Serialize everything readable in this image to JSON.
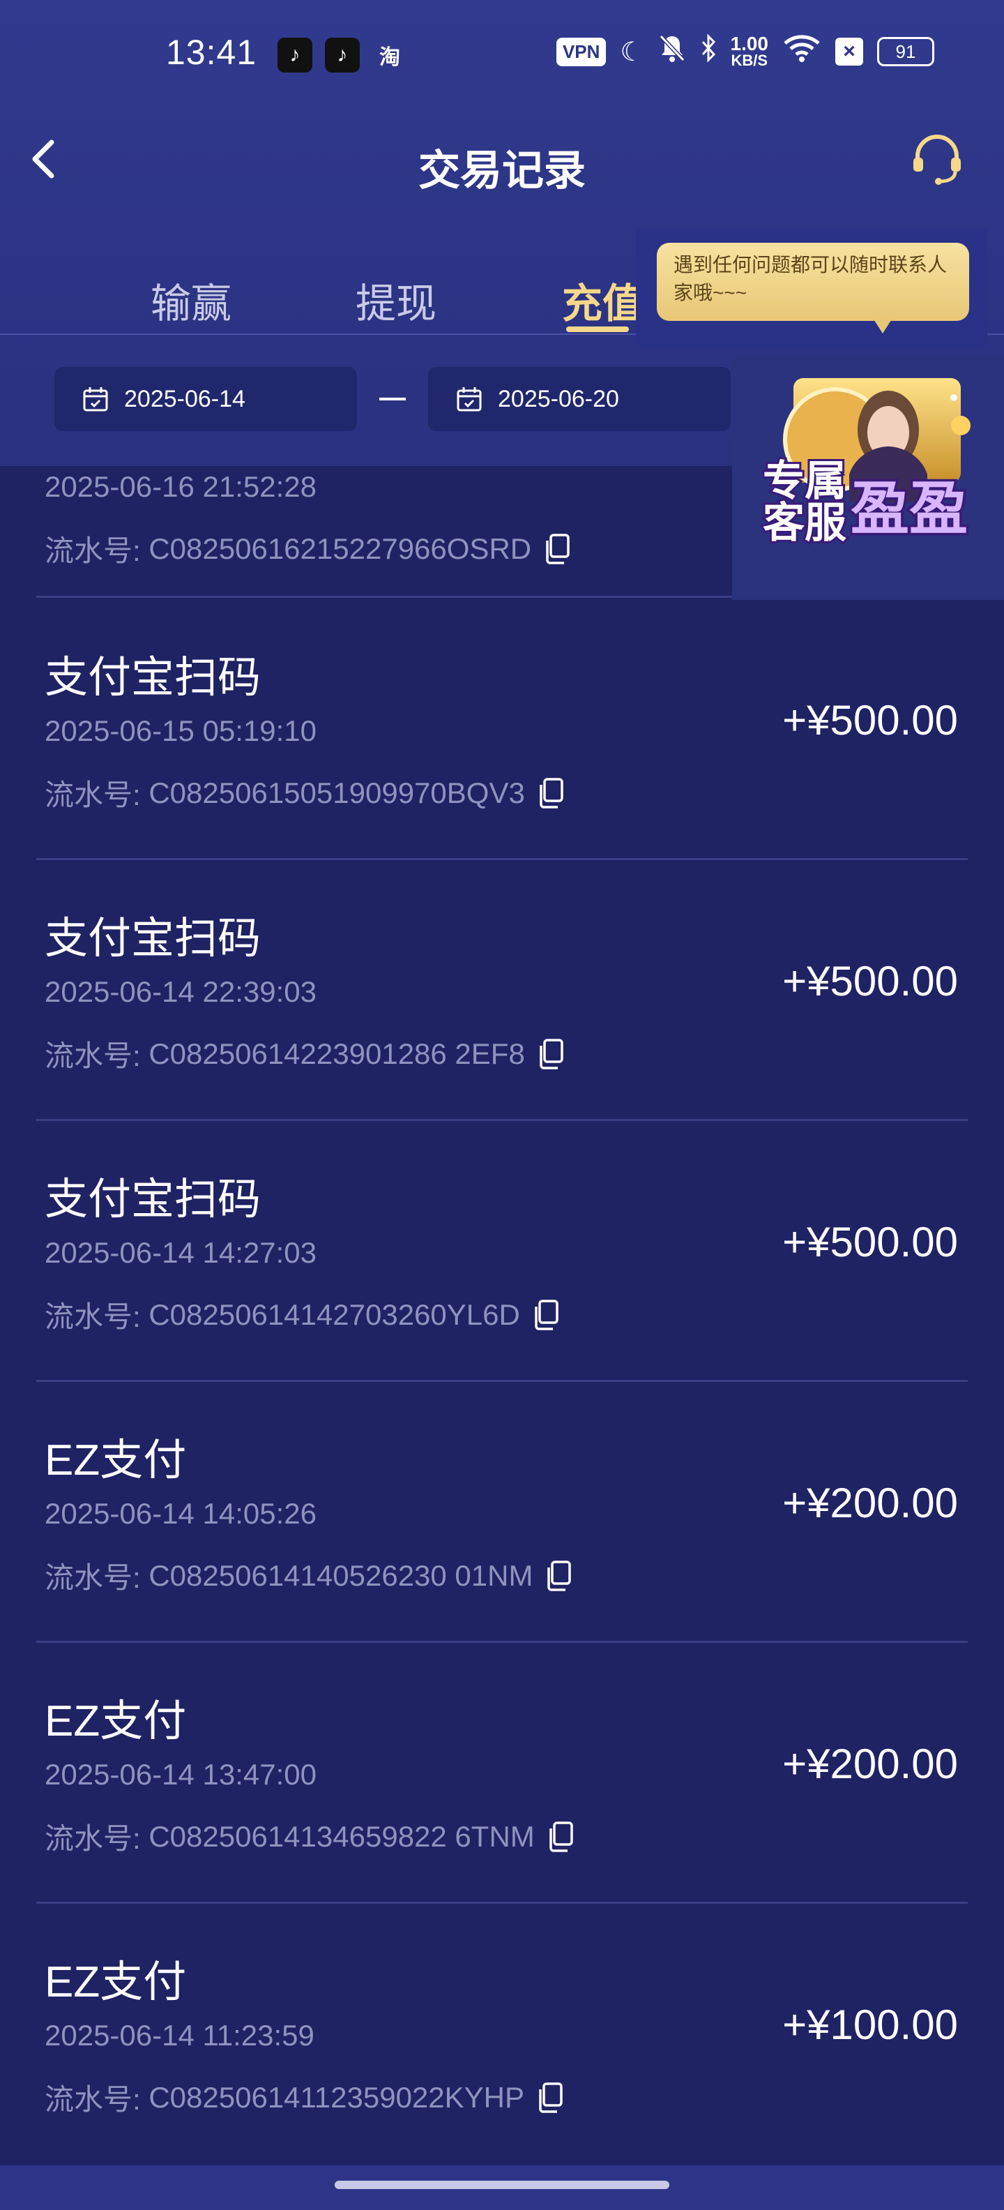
{
  "status_bar": {
    "time": "13:41",
    "apps": [
      "tiktok-lite-icon",
      "tiktok-icon",
      "taobao-icon"
    ],
    "taobao_label": "淘",
    "vpn_label": "VPN",
    "speed_value": "1.00",
    "speed_unit": "KB/S",
    "battery": "91"
  },
  "nav": {
    "title": "交易记录"
  },
  "tabs": [
    {
      "label": "输赢",
      "active": false
    },
    {
      "label": "提现",
      "active": false
    },
    {
      "label": "充值",
      "active": true
    }
  ],
  "date_filter": {
    "start": "2025-06-14",
    "end": "2025-06-20"
  },
  "tooltip": {
    "text": "遇到任何问题都可以随时联系人家哦~~~"
  },
  "promo": {
    "line1": "专属",
    "line2": "客服",
    "name": "盈盈"
  },
  "serial_label": "流水号:",
  "partial_item": {
    "time": "2025-06-16 21:52:28",
    "serial": "C08250616215227966OSRD"
  },
  "items": [
    {
      "title": "支付宝扫码",
      "time": "2025-06-15 05:19:10",
      "serial": "C08250615051909970BQV3",
      "amount": "+¥500.00"
    },
    {
      "title": "支付宝扫码",
      "time": "2025-06-14 22:39:03",
      "serial": "C08250614223901286 2EF8",
      "amount": "+¥500.00"
    },
    {
      "title": "支付宝扫码",
      "time": "2025-06-14 14:27:03",
      "serial": "C08250614142703260YL6D",
      "amount": "+¥500.00"
    },
    {
      "title": "EZ支付",
      "time": "2025-06-14 14:05:26",
      "serial": "C08250614140526230 01NM",
      "amount": "+¥200.00"
    },
    {
      "title": "EZ支付",
      "time": "2025-06-14 13:47:00",
      "serial": "C08250614134659822 6TNM",
      "amount": "+¥200.00"
    },
    {
      "title": "EZ支付",
      "time": "2025-06-14 11:23:59",
      "serial": "C08250614112359022KYHP",
      "amount": "+¥100.00"
    }
  ],
  "colors": {
    "background": "#1f2263",
    "header": "#2d3485",
    "active_tab": "#f6d88a",
    "muted_text": "#8f93bf"
  }
}
